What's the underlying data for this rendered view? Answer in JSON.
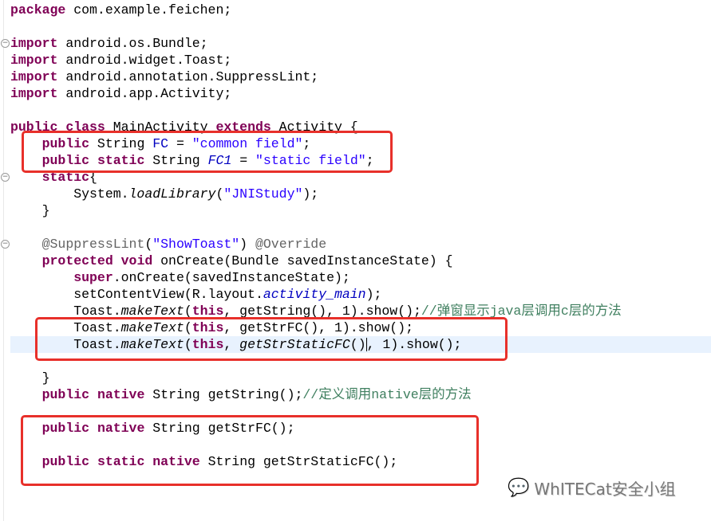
{
  "editor": {
    "current_line": 20,
    "lines": [
      [
        [
          "package",
          "kw"
        ],
        [
          " com.example.feichen;",
          ""
        ]
      ],
      [],
      [
        [
          "import",
          "kw"
        ],
        [
          " android.os.Bundle;",
          ""
        ]
      ],
      [
        [
          "import",
          "kw"
        ],
        [
          " android.widget.Toast;",
          ""
        ]
      ],
      [
        [
          "import",
          "kw"
        ],
        [
          " android.annotation.SuppressLint;",
          ""
        ]
      ],
      [
        [
          "import",
          "kw"
        ],
        [
          " android.app.Activity;",
          ""
        ]
      ],
      [],
      [
        [
          "public",
          "kw"
        ],
        [
          " ",
          ""
        ],
        [
          "class",
          "kw"
        ],
        [
          " MainActivity ",
          ""
        ],
        [
          "extends",
          "kw"
        ],
        [
          " Activity {",
          ""
        ]
      ],
      [
        [
          "    ",
          ""
        ],
        [
          "public",
          "kw"
        ],
        [
          " String ",
          ""
        ],
        [
          "FC",
          "fld"
        ],
        [
          " = ",
          ""
        ],
        [
          "\"common field\"",
          "str"
        ],
        [
          ";",
          ""
        ]
      ],
      [
        [
          "    ",
          ""
        ],
        [
          "public",
          "kw"
        ],
        [
          " ",
          ""
        ],
        [
          "static",
          "kw"
        ],
        [
          " String ",
          ""
        ],
        [
          "FC1",
          "sfld"
        ],
        [
          " = ",
          ""
        ],
        [
          "\"static field\"",
          "str"
        ],
        [
          ";",
          ""
        ]
      ],
      [
        [
          "    ",
          ""
        ],
        [
          "static",
          "kw"
        ],
        [
          "{",
          ""
        ]
      ],
      [
        [
          "        System.",
          ""
        ],
        [
          "loadLibrary",
          "it"
        ],
        [
          "(",
          ""
        ],
        [
          "\"JNIStudy\"",
          "str"
        ],
        [
          ");",
          ""
        ]
      ],
      [
        [
          "    }",
          ""
        ]
      ],
      [],
      [
        [
          "    ",
          ""
        ],
        [
          "@SuppressLint",
          "ann"
        ],
        [
          "(",
          ""
        ],
        [
          "\"ShowToast\"",
          "str"
        ],
        [
          ") ",
          ""
        ],
        [
          "@Override",
          "ann"
        ]
      ],
      [
        [
          "    ",
          ""
        ],
        [
          "protected",
          "kw"
        ],
        [
          " ",
          ""
        ],
        [
          "void",
          "kw"
        ],
        [
          " onCreate(Bundle savedInstanceState) {",
          ""
        ]
      ],
      [
        [
          "        ",
          ""
        ],
        [
          "super",
          "kw"
        ],
        [
          ".onCreate(savedInstanceState);",
          ""
        ]
      ],
      [
        [
          "        setContentView(R.layout.",
          ""
        ],
        [
          "activity_main",
          "sfld"
        ],
        [
          ");",
          ""
        ]
      ],
      [
        [
          "        Toast.",
          ""
        ],
        [
          "makeText",
          "it"
        ],
        [
          "(",
          ""
        ],
        [
          "this",
          "kw"
        ],
        [
          ", getString(), 1).show();",
          ""
        ],
        [
          "//弹窗显示java层调用c层的方法",
          "cmt"
        ]
      ],
      [
        [
          "        Toast.",
          ""
        ],
        [
          "makeText",
          "it"
        ],
        [
          "(",
          ""
        ],
        [
          "this",
          "kw"
        ],
        [
          ", getStrFC(), 1).show();",
          ""
        ]
      ],
      [
        [
          "        Toast.",
          ""
        ],
        [
          "makeText",
          "it"
        ],
        [
          "(",
          ""
        ],
        [
          "this",
          "kw"
        ],
        [
          ", ",
          ""
        ],
        [
          "getStrStaticFC",
          "it"
        ],
        [
          "()",
          ""
        ],
        [
          "|",
          "caret"
        ],
        [
          ", 1).show();",
          ""
        ]
      ],
      [],
      [
        [
          "    }",
          ""
        ]
      ],
      [
        [
          "    ",
          ""
        ],
        [
          "public",
          "kw"
        ],
        [
          " ",
          ""
        ],
        [
          "native",
          "kw"
        ],
        [
          " String getString();",
          ""
        ],
        [
          "//定义调用native层的方法",
          "cmt"
        ]
      ],
      [],
      [
        [
          "    ",
          ""
        ],
        [
          "public",
          "kw"
        ],
        [
          " ",
          ""
        ],
        [
          "native",
          "kw"
        ],
        [
          " String getStrFC();",
          ""
        ]
      ],
      [],
      [
        [
          "    ",
          ""
        ],
        [
          "public",
          "kw"
        ],
        [
          " ",
          ""
        ],
        [
          "static",
          "kw"
        ],
        [
          " ",
          ""
        ],
        [
          "native",
          "kw"
        ],
        [
          " String getStrStaticFC();",
          ""
        ]
      ]
    ],
    "fold_lines": [
      2,
      10,
      14
    ]
  },
  "watermark": {
    "icon": "wechat-icon",
    "text": "WhITECat安全小组"
  },
  "colors": {
    "highlight_box": "#e8302a",
    "keyword": "#7f0055",
    "string": "#2a00ff",
    "comment": "#3f7f5f"
  }
}
